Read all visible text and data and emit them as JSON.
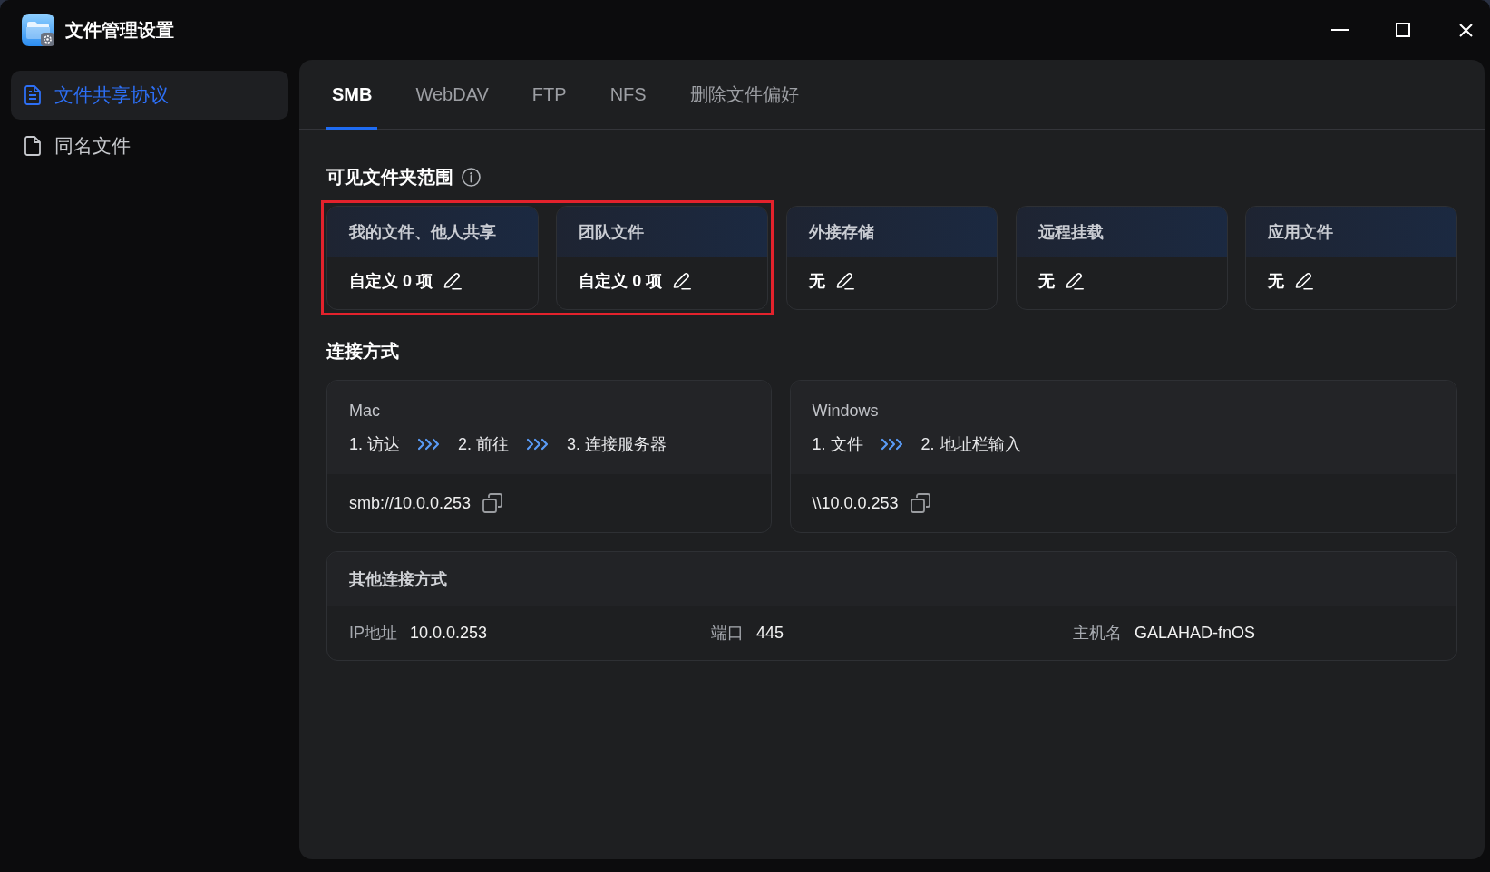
{
  "window": {
    "title": "文件管理设置"
  },
  "sidebar": {
    "items": [
      {
        "label": "文件共享协议",
        "selected": true
      },
      {
        "label": "同名文件",
        "selected": false
      }
    ]
  },
  "tabs": [
    {
      "label": "SMB",
      "selected": true
    },
    {
      "label": "WebDAV",
      "selected": false
    },
    {
      "label": "FTP",
      "selected": false
    },
    {
      "label": "NFS",
      "selected": false
    },
    {
      "label": "删除文件偏好",
      "selected": false
    }
  ],
  "visible_folders": {
    "title": "可见文件夹范围",
    "cards": [
      {
        "title": "我的文件、他人共享",
        "value": "自定义 0 项",
        "highlighted": true
      },
      {
        "title": "团队文件",
        "value": "自定义 0 项",
        "highlighted": true
      },
      {
        "title": "外接存储",
        "value": "无",
        "highlighted": false
      },
      {
        "title": "远程挂载",
        "value": "无",
        "highlighted": false
      },
      {
        "title": "应用文件",
        "value": "无",
        "highlighted": false
      }
    ]
  },
  "connection": {
    "title": "连接方式",
    "platforms": [
      {
        "name": "Mac",
        "steps": [
          "1. 访达",
          "2. 前往",
          "3. 连接服务器"
        ],
        "address": "smb://10.0.0.253"
      },
      {
        "name": "Windows",
        "steps": [
          "1. 文件",
          "2. 地址栏输入"
        ],
        "address": "\\\\10.0.0.253"
      }
    ]
  },
  "other_connection": {
    "title": "其他连接方式",
    "fields": [
      {
        "label": "IP地址",
        "value": "10.0.0.253"
      },
      {
        "label": "端口",
        "value": "445"
      },
      {
        "label": "主机名",
        "value": "GALAHAD-fnOS"
      }
    ]
  }
}
